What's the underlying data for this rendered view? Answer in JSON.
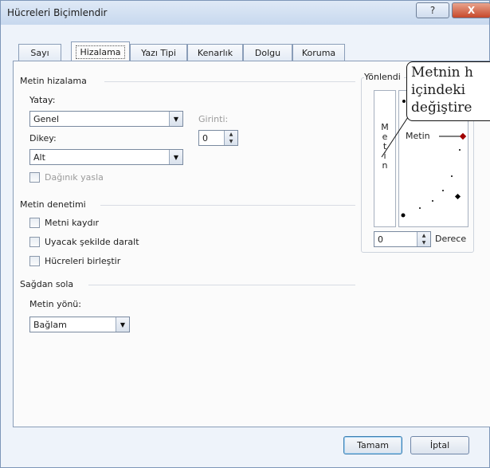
{
  "window": {
    "title": "Hücreleri Biçimlendir",
    "help_label": "?",
    "close_label": "X"
  },
  "tabs": [
    {
      "label": "Sayı"
    },
    {
      "label": "Hizalama",
      "active": true
    },
    {
      "label": "Yazı Tipi"
    },
    {
      "label": "Kenarlık"
    },
    {
      "label": "Dolgu"
    },
    {
      "label": "Koruma"
    }
  ],
  "text_alignment": {
    "title": "Metin hizalama",
    "horizontal_label": "Yatay:",
    "horizontal_value": "Genel",
    "indent_label": "Girinti:",
    "indent_value": "0",
    "vertical_label": "Dikey:",
    "vertical_value": "Alt",
    "distributed_label": "Dağınık yasla"
  },
  "text_control": {
    "title": "Metin denetimi",
    "wrap_label": "Metni kaydır",
    "shrink_label": "Uyacak şekilde daralt",
    "merge_label": "Hücreleri birleştir"
  },
  "rtl": {
    "title": "Sağdan sola",
    "direction_label": "Metin yönü:",
    "direction_value": "Bağlam"
  },
  "orientation": {
    "title": "Yönlendi",
    "vertical_letters": [
      "M",
      "e",
      "t",
      "i",
      "n"
    ],
    "dial_label": "Metin",
    "degrees_value": "0",
    "degrees_label": "Derece",
    "accent_color": "#a00000"
  },
  "callout": {
    "lines": [
      "Metnin h",
      "içindeki",
      "değiştire"
    ]
  },
  "buttons": {
    "ok": "Tamam",
    "cancel": "İptal"
  }
}
